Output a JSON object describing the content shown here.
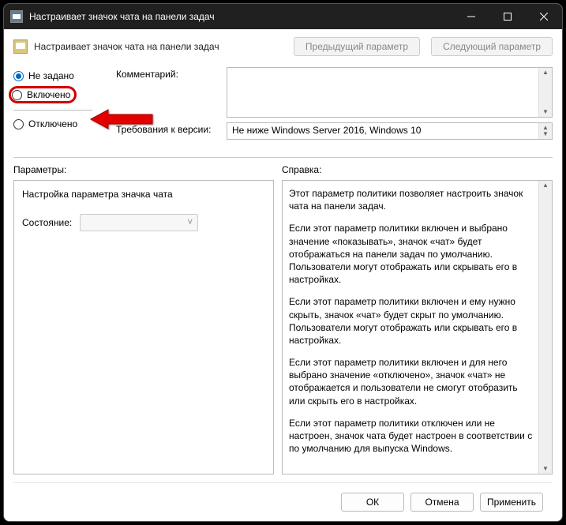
{
  "titlebar": {
    "title": "Настраивает значок чата на панели задач"
  },
  "header": {
    "title": "Настраивает значок чата на панели задач",
    "prev": "Предыдущий параметр",
    "next": "Следующий параметр"
  },
  "radios": {
    "not_configured": "Не задано",
    "enabled": "Включено",
    "disabled": "Отключено"
  },
  "fields": {
    "comment_label": "Комментарий:",
    "requirements_label": "Требования к версии:",
    "requirements_value": "Не ниже Windows Server 2016, Windows 10"
  },
  "sections": {
    "params_label": "Параметры:",
    "help_label": "Справка:"
  },
  "params": {
    "title": "Настройка параметра значка чата",
    "state_label": "Состояние:"
  },
  "help": {
    "p1": "Этот параметр политики позволяет настроить значок чата на панели задач.",
    "p2": "Если этот параметр политики включен и выбрано значение «показывать», значок «чат» будет отображаться на панели задач по умолчанию. Пользователи могут отображать или скрывать его в настройках.",
    "p3": "Если этот параметр политики включен и ему нужно скрыть, значок «чат» будет скрыт по умолчанию. Пользователи могут отображать или скрывать его в настройках.",
    "p4": "Если этот параметр политики включен и для него выбрано значение «отключено», значок «чат» не отображается и пользователи не смогут отобразить или скрыть его в настройках.",
    "p5": "Если этот параметр политики отключен или не настроен, значок чата будет настроен в соответствии с по умолчанию для выпуска Windows."
  },
  "buttons": {
    "ok": "ОК",
    "cancel": "Отмена",
    "apply": "Применить"
  }
}
